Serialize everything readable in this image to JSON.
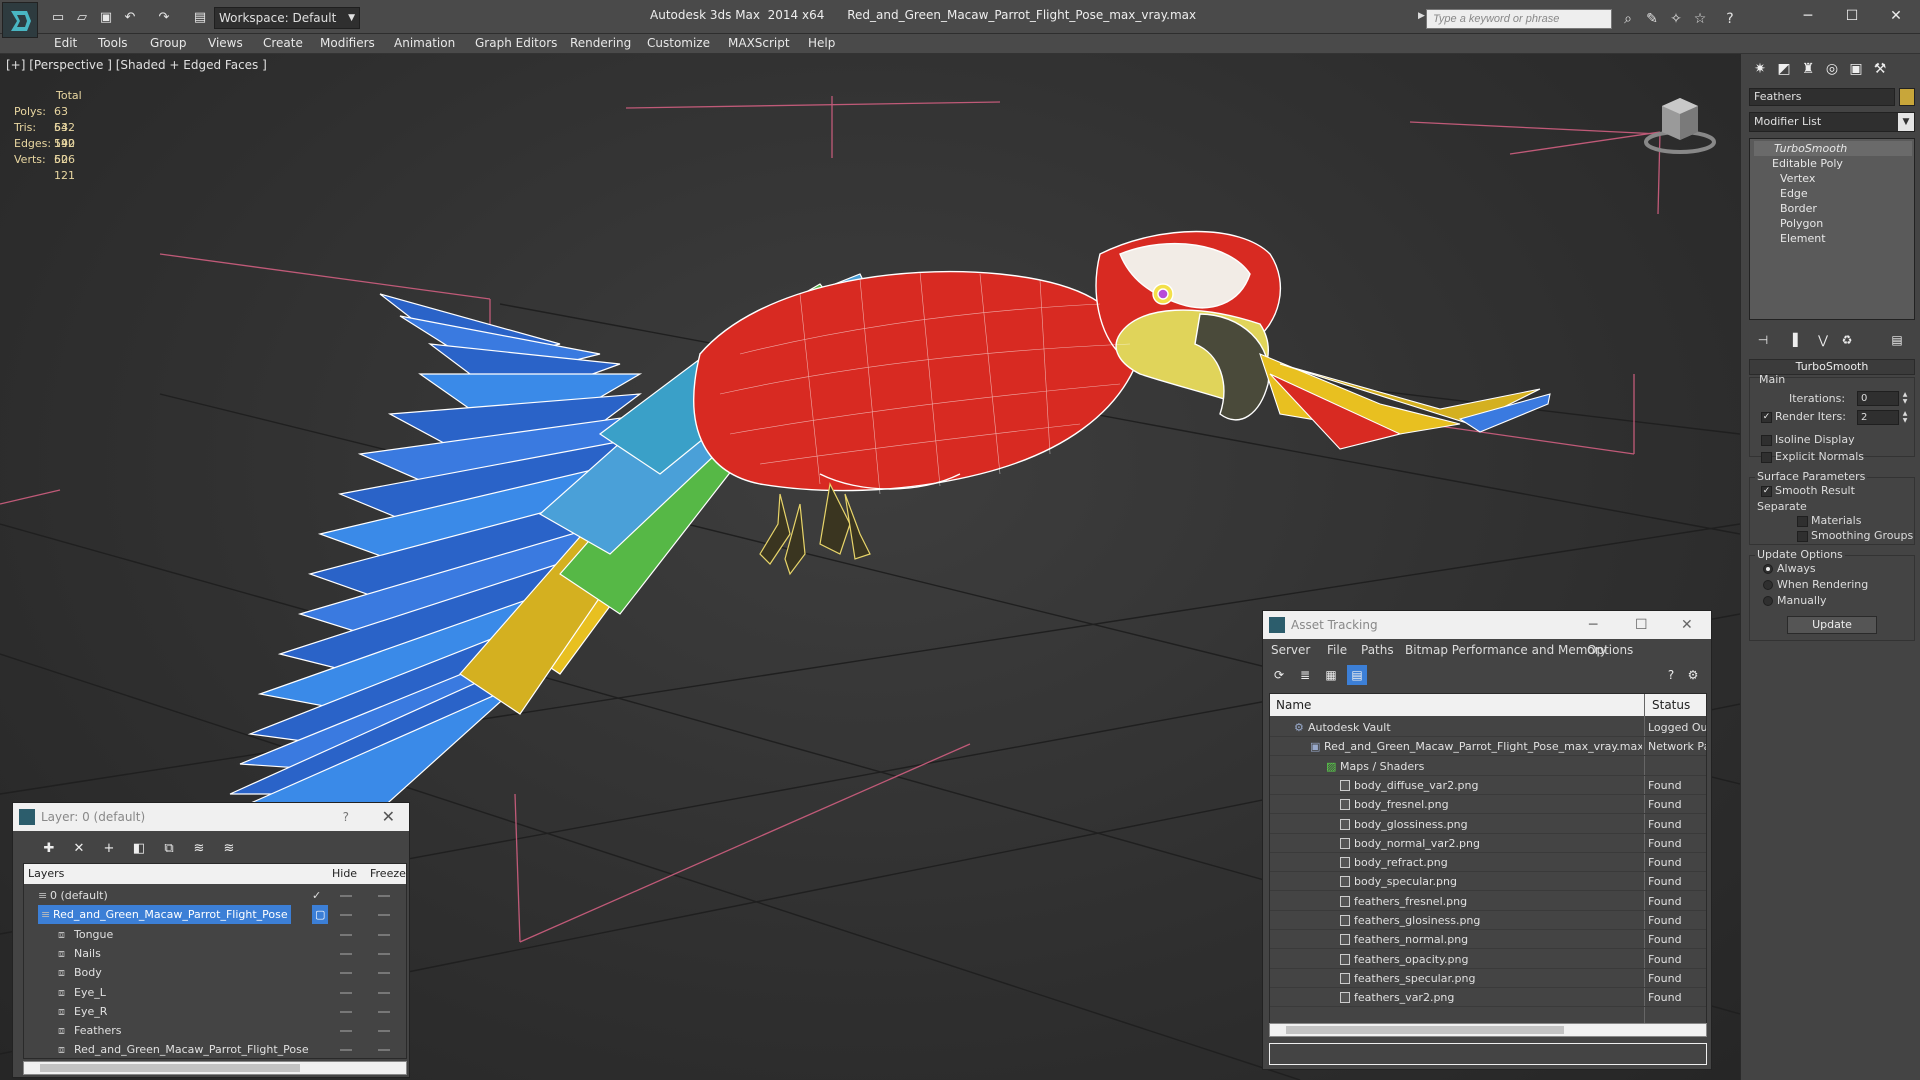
{
  "titlebar": {
    "workspace_label": "Workspace: Default",
    "app_title": "Autodesk 3ds Max  2014 x64      Red_and_Green_Macaw_Parrot_Flight_Pose_max_vray.max",
    "search_placeholder": "Type a keyword or phrase"
  },
  "menu": {
    "items": [
      "Edit",
      "Tools",
      "Group",
      "Views",
      "Create",
      "Modifiers",
      "Animation",
      "Graph Editors",
      "Rendering",
      "Customize",
      "MAXScript",
      "Help"
    ]
  },
  "viewport": {
    "label": "[+] [Perspective ] [Shaded + Edged Faces ]",
    "stats": {
      "header": "Total",
      "polys_label": "Polys:",
      "polys": "63 542",
      "tris_label": "Tris:",
      "tris": "63 542",
      "edges_label": "Edges:",
      "edges": "190 626",
      "verts_label": "Verts:",
      "verts": "50 121"
    }
  },
  "command_panel": {
    "object_name": "Feathers",
    "object_color": "#c8a63a",
    "modifier_list": "Modifier List",
    "stack": [
      "TurboSmooth",
      "Editable Poly",
      "Vertex",
      "Edge",
      "Border",
      "Polygon",
      "Element"
    ],
    "turbosmooth": {
      "title": "TurboSmooth",
      "main": "Main",
      "iterations_label": "Iterations:",
      "iterations": "0",
      "render_iters_label": "Render Iters:",
      "render_iters": "2",
      "isoline": "Isoline Display",
      "explicit_normals": "Explicit Normals",
      "surface_params": "Surface Parameters",
      "smooth_result": "Smooth Result",
      "separate": "Separate",
      "materials": "Materials",
      "smoothing_groups": "Smoothing Groups",
      "update_options": "Update Options",
      "always": "Always",
      "when_rendering": "When Rendering",
      "manually": "Manually",
      "update": "Update"
    }
  },
  "layer_dialog": {
    "title": "Layer: 0 (default)",
    "help": "?",
    "columns": {
      "layers": "Layers",
      "hide": "Hide",
      "freeze": "Freeze"
    },
    "rows": [
      {
        "name": "0 (default)",
        "indent": 0
      },
      {
        "name": "Red_and_Green_Macaw_Parrot_Flight_Pose",
        "indent": 0
      },
      {
        "name": "Tongue",
        "indent": 1
      },
      {
        "name": "Nails",
        "indent": 1
      },
      {
        "name": "Body",
        "indent": 1
      },
      {
        "name": "Eye_L",
        "indent": 1
      },
      {
        "name": "Eye_R",
        "indent": 1
      },
      {
        "name": "Feathers",
        "indent": 1
      },
      {
        "name": "Red_and_Green_Macaw_Parrot_Flight_Pose",
        "indent": 1
      }
    ]
  },
  "asset_dialog": {
    "title": "Asset Tracking",
    "menu": [
      "Server",
      "File",
      "Paths",
      "Bitmap Performance and Memory",
      "Options"
    ],
    "columns": {
      "name": "Name",
      "status": "Status"
    },
    "rows": [
      {
        "name": "Autodesk Vault",
        "status": "Logged Out",
        "indent": 0
      },
      {
        "name": "Red_and_Green_Macaw_Parrot_Flight_Pose_max_vray.max",
        "status": "Network Path",
        "indent": 1
      },
      {
        "name": "Maps / Shaders",
        "status": "",
        "indent": 2
      },
      {
        "name": "body_diffuse_var2.png",
        "status": "Found",
        "indent": 3
      },
      {
        "name": "body_fresnel.png",
        "status": "Found",
        "indent": 3
      },
      {
        "name": "body_glossiness.png",
        "status": "Found",
        "indent": 3
      },
      {
        "name": "body_normal_var2.png",
        "status": "Found",
        "indent": 3
      },
      {
        "name": "body_refract.png",
        "status": "Found",
        "indent": 3
      },
      {
        "name": "body_specular.png",
        "status": "Found",
        "indent": 3
      },
      {
        "name": "feathers_fresnel.png",
        "status": "Found",
        "indent": 3
      },
      {
        "name": "feathers_glosiness.png",
        "status": "Found",
        "indent": 3
      },
      {
        "name": "feathers_normal.png",
        "status": "Found",
        "indent": 3
      },
      {
        "name": "feathers_opacity.png",
        "status": "Found",
        "indent": 3
      },
      {
        "name": "feathers_specular.png",
        "status": "Found",
        "indent": 3
      },
      {
        "name": "feathers_var2.png",
        "status": "Found",
        "indent": 3
      }
    ]
  }
}
